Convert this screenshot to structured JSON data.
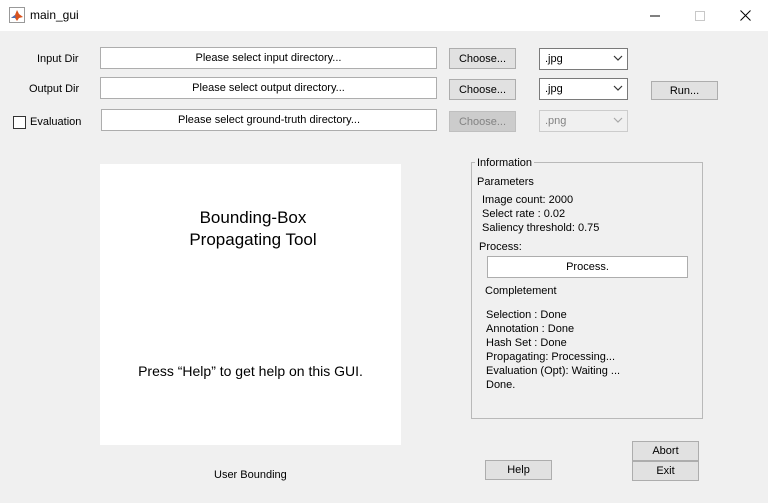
{
  "window": {
    "title": "main_gui"
  },
  "inputs": {
    "input_dir": {
      "label": "Input Dir",
      "value": "Please select input directory...",
      "choose_label": "Choose...",
      "format": ".jpg"
    },
    "output_dir": {
      "label": "Output Dir",
      "value": "Please select output directory...",
      "choose_label": "Choose...",
      "format": ".jpg"
    },
    "evaluation": {
      "label": "Evaluation",
      "checked": false,
      "value": "Please select ground-truth directory...",
      "choose_label": "Choose...",
      "format": ".png"
    }
  },
  "run_label": "Run...",
  "canvas": {
    "title_line1": "Bounding-Box",
    "title_line2": "Propagating Tool",
    "help_text": "Press “Help” to get help on this GUI."
  },
  "user_bounding_label": "User Bounding",
  "info": {
    "legend": "Information",
    "parameters_label": "Parameters",
    "image_count": "Image count: 2000",
    "select_rate": "Select rate : 0.02",
    "saliency_threshold": "Saliency threshold: 0.75",
    "process_label": "Process:",
    "process_value": "Process.",
    "completement_label": "Completement",
    "status_lines": [
      "Selection : Done",
      "Annotation : Done",
      "Hash Set : Done",
      "Propagating: Processing...",
      "Evaluation (Opt): Waiting ...",
      "Done."
    ]
  },
  "buttons": {
    "help": "Help",
    "abort": "Abort",
    "exit": "Exit"
  },
  "icons": {
    "app": "matlab-icon",
    "minimize": "minimize-icon",
    "maximize": "maximize-icon",
    "close": "close-icon",
    "dropdown": "chevron-down-icon"
  }
}
